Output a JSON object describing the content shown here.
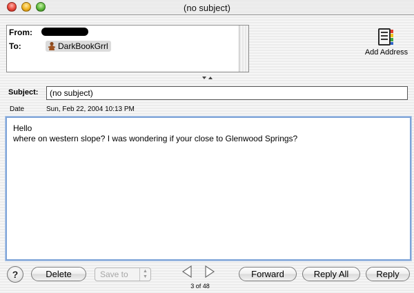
{
  "window": {
    "title": "(no subject)"
  },
  "header": {
    "from_label": "From:",
    "to_label": "To:",
    "to_recipient": "DarkBookGrrl",
    "add_address_label": "Add Address"
  },
  "fields": {
    "subject_label": "Subject:",
    "subject_value": "(no subject)",
    "date_label": "Date",
    "date_value": "Sun, Feb 22, 2004 10:13 PM"
  },
  "message": {
    "lines": [
      "Hello",
      "where on western slope? I was wondering if your close to Glenwood Springs?"
    ]
  },
  "toolbar": {
    "help_label": "?",
    "delete_label": "Delete",
    "save_to_label": "Save to",
    "forward_label": "Forward",
    "reply_all_label": "Reply All",
    "reply_label": "Reply",
    "page_count": "3 of 48"
  },
  "colors": {
    "body_border": "#7ea4d8",
    "close": "#e8473a",
    "minimize": "#f0b21f",
    "zoom": "#5cb83a"
  },
  "icons": {
    "recipient": "person-icon",
    "add_address": "address-book-icon",
    "prev": "triangle-left-icon",
    "next": "triangle-right-icon"
  }
}
